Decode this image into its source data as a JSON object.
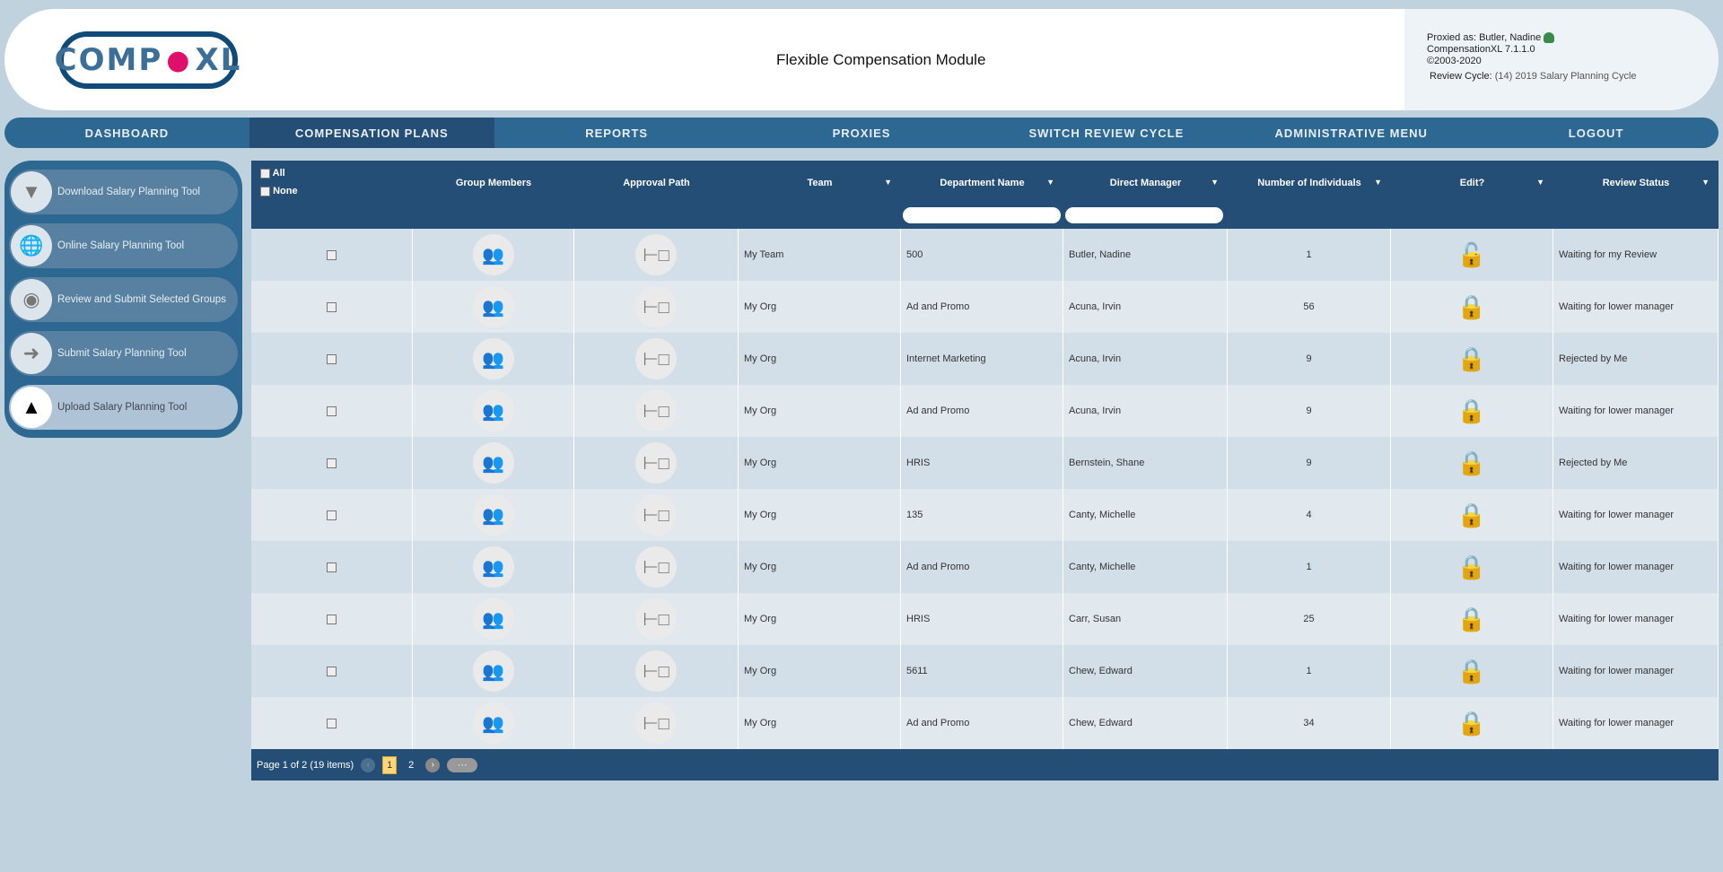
{
  "header": {
    "logo_text": "COMP·XL",
    "title": "Flexible Compensation Module",
    "proxied_label": "Proxied as:",
    "proxied_name": "Butler, Nadine",
    "version": "CompensationXL 7.1.1.0",
    "copyright": "©2003-2020",
    "review_cycle_label": "Review Cycle:",
    "review_cycle_value": "(14) 2019 Salary Planning Cycle"
  },
  "nav": [
    "DASHBOARD",
    "COMPENSATION PLANS",
    "REPORTS",
    "PROXIES",
    "SWITCH REVIEW CYCLE",
    "ADMINISTRATIVE MENU",
    "LOGOUT"
  ],
  "sidebar": [
    "Download Salary Planning Tool",
    "Online Salary Planning Tool",
    "Review and Submit Selected Groups",
    "Submit Salary Planning Tool",
    "Upload Salary Planning Tool"
  ],
  "table": {
    "select_all": "All",
    "select_none": "None",
    "columns": [
      "Group Members",
      "Approval Path",
      "Team",
      "Department Name",
      "Direct Manager",
      "Number of Individuals",
      "Edit?",
      "Review Status"
    ],
    "rows": [
      {
        "team": "My Team",
        "dept": "500",
        "manager": "Butler, Nadine",
        "count": "1",
        "locked": false,
        "status": "Waiting for my Review"
      },
      {
        "team": "My Org",
        "dept": "Ad and Promo",
        "manager": "Acuna, Irvin",
        "count": "56",
        "locked": true,
        "status": "Waiting for lower manager"
      },
      {
        "team": "My Org",
        "dept": "Internet Marketing",
        "manager": "Acuna, Irvin",
        "count": "9",
        "locked": true,
        "status": "Rejected by Me"
      },
      {
        "team": "My Org",
        "dept": "Ad and Promo",
        "manager": "Acuna, Irvin",
        "count": "9",
        "locked": true,
        "status": "Waiting for lower manager"
      },
      {
        "team": "My Org",
        "dept": "HRIS",
        "manager": "Bernstein, Shane",
        "count": "9",
        "locked": true,
        "status": "Rejected by Me"
      },
      {
        "team": "My Org",
        "dept": "135",
        "manager": "Canty, Michelle",
        "count": "4",
        "locked": true,
        "status": "Waiting for lower manager"
      },
      {
        "team": "My Org",
        "dept": "Ad and Promo",
        "manager": "Canty, Michelle",
        "count": "1",
        "locked": true,
        "status": "Waiting for lower manager"
      },
      {
        "team": "My Org",
        "dept": "HRIS",
        "manager": "Carr, Susan",
        "count": "25",
        "locked": true,
        "status": "Waiting for lower manager"
      },
      {
        "team": "My Org",
        "dept": "5611",
        "manager": "Chew, Edward",
        "count": "1",
        "locked": true,
        "status": "Waiting for lower manager"
      },
      {
        "team": "My Org",
        "dept": "Ad and Promo",
        "manager": "Chew, Edward",
        "count": "34",
        "locked": true,
        "status": "Waiting for lower manager"
      }
    ]
  },
  "pager": {
    "summary": "Page 1 of 2 (19 items)",
    "pages": [
      "1",
      "2"
    ],
    "current": "1",
    "more": "···"
  }
}
